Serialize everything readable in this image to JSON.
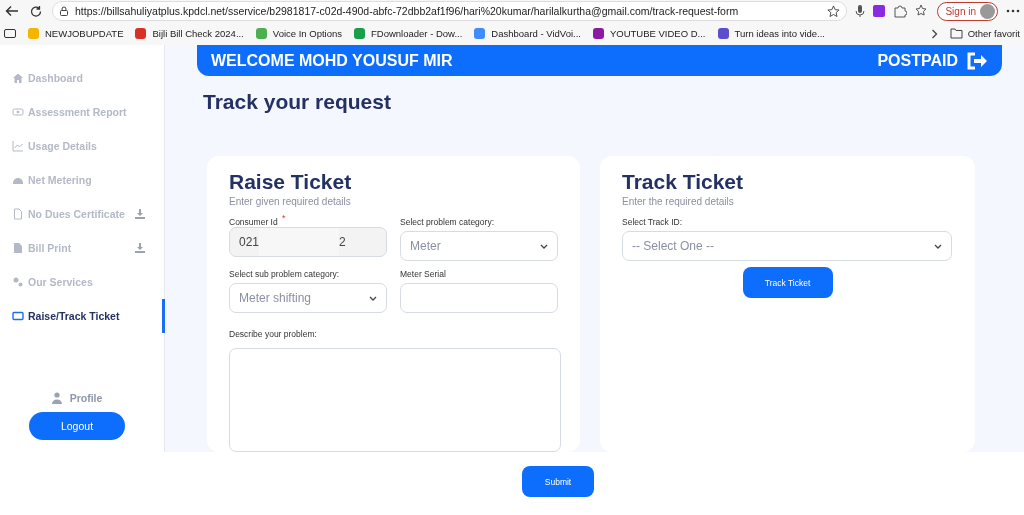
{
  "browser": {
    "url": "https://billsahuliyatplus.kpdcl.net/sservice/b2981817-c02d-490d-abfc-72dbb2af1f96/hari%20kumar/harilalkurtha@gmail.com/track-request-form",
    "sign_in": "Sign in",
    "bookmarks": [
      "NEWJOBUPDATE",
      "Bijli Bill Check 2024...",
      "Voice In Options",
      "FDownloader - Dow...",
      "Dashboard - VidVoi...",
      "YOUTUBE VIDEO D...",
      "Turn ideas into vide..."
    ],
    "other_favorites": "Other favorit"
  },
  "sidebar": {
    "items": [
      {
        "label": "Dashboard",
        "download": false,
        "selected": false
      },
      {
        "label": "Assessment Report",
        "download": false,
        "selected": false
      },
      {
        "label": "Usage Details",
        "download": false,
        "selected": false
      },
      {
        "label": "Net Metering",
        "download": false,
        "selected": false
      },
      {
        "label": "No Dues Certificate",
        "download": true,
        "selected": false
      },
      {
        "label": "Bill Print",
        "download": true,
        "selected": false
      },
      {
        "label": "Our Services",
        "download": false,
        "selected": false
      },
      {
        "label": "Raise/Track Ticket",
        "download": false,
        "selected": true
      }
    ],
    "profile": "Profile",
    "logout": "Logout"
  },
  "banner": {
    "welcome": "WELCOME MOHD YOUSUF MIR",
    "plan": "POSTPAID"
  },
  "page_title": "Track your request",
  "raise": {
    "title": "Raise Ticket",
    "subtitle": "Enter given required details",
    "consumer_label": "Consumer Id",
    "consumer_required_mark": "*",
    "consumer_value": [
      "021",
      "2"
    ],
    "category_label": "Select problem category:",
    "category_value": "Meter",
    "sub_label": "Select sub problem category:",
    "sub_value": "Meter shifting",
    "serial_label": "Meter Serial",
    "describe_label": "Describe your problem:",
    "submit": "Submit"
  },
  "track": {
    "title": "Track Ticket",
    "subtitle": "Enter the required details",
    "id_label": "Select Track ID:",
    "id_value": "-- Select One --",
    "button": "Track Ticket"
  }
}
